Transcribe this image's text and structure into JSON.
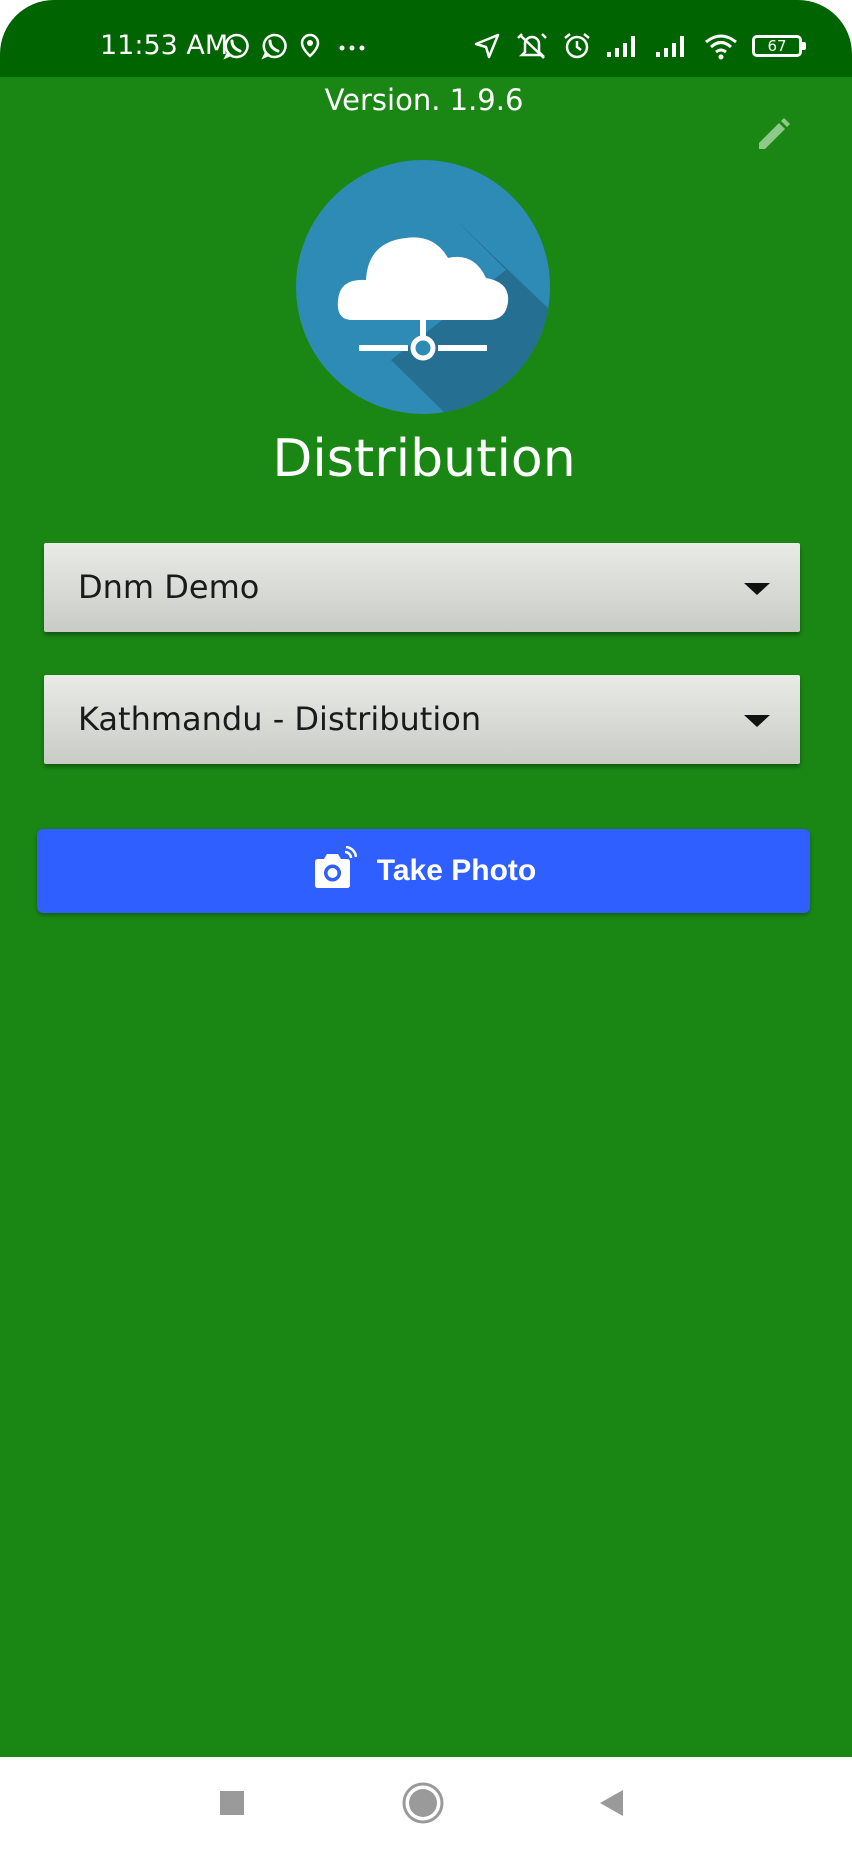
{
  "status_bar": {
    "time": "11:53 AM",
    "battery": "67",
    "left_icons": [
      "whatsapp-icon",
      "whatsapp-icon",
      "location-pin-icon",
      "more-dots-icon"
    ],
    "right_icons": [
      "navigation-arrow-icon",
      "alarm-off-icon",
      "alarm-icon",
      "signal-icon",
      "signal-icon",
      "wifi-icon",
      "battery-icon"
    ]
  },
  "header": {
    "version": "Version. 1.9.6",
    "edit_icon": "pencil-icon"
  },
  "logo": {
    "icon": "cloud-network-icon",
    "circle_color": "#2e8bb5"
  },
  "app_title": "Distribution",
  "form": {
    "company_select": {
      "value": "Dnm Demo"
    },
    "branch_select": {
      "value": "Kathmandu - Distribution"
    },
    "take_photo": {
      "label": "Take Photo",
      "icon": "camera-icon"
    }
  },
  "nav_bar": {
    "icons": [
      "recent-apps-icon",
      "home-icon",
      "back-icon"
    ]
  },
  "colors": {
    "status_bar": "#006400",
    "background": "#1a8714",
    "button": "#2f5ffe"
  }
}
